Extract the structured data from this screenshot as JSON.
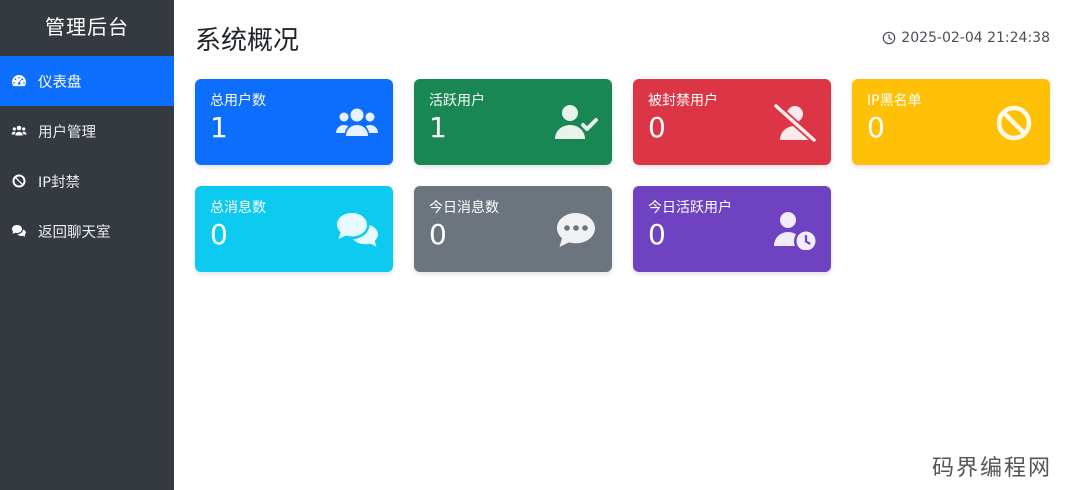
{
  "sidebar": {
    "title": "管理后台",
    "items": [
      {
        "label": "仪表盘",
        "icon": "dashboard-icon",
        "active": true
      },
      {
        "label": "用户管理",
        "icon": "users-icon",
        "active": false
      },
      {
        "label": "IP封禁",
        "icon": "ban-icon",
        "active": false
      },
      {
        "label": "返回聊天室",
        "icon": "chat-icon",
        "active": false
      }
    ]
  },
  "header": {
    "title": "系统概况",
    "datetime": "2025-02-04 21:24:38",
    "clock_icon": "clock-icon"
  },
  "cards": [
    {
      "label": "总用户数",
      "value": "1",
      "color": "#0d6efd",
      "icon": "users-icon"
    },
    {
      "label": "活跃用户",
      "value": "1",
      "color": "#198754",
      "icon": "user-check-icon"
    },
    {
      "label": "被封禁用户",
      "value": "0",
      "color": "#dc3545",
      "icon": "user-slash-icon"
    },
    {
      "label": "IP黑名单",
      "value": "0",
      "color": "#ffc107",
      "icon": "ban-icon"
    },
    {
      "label": "总消息数",
      "value": "0",
      "color": "#0dcaf0",
      "icon": "comments-icon"
    },
    {
      "label": "今日消息数",
      "value": "0",
      "color": "#6c757d",
      "icon": "comment-dots-icon"
    },
    {
      "label": "今日活跃用户",
      "value": "0",
      "color": "#6f42c1",
      "icon": "user-clock-icon"
    }
  ],
  "watermark": "码界编程网"
}
